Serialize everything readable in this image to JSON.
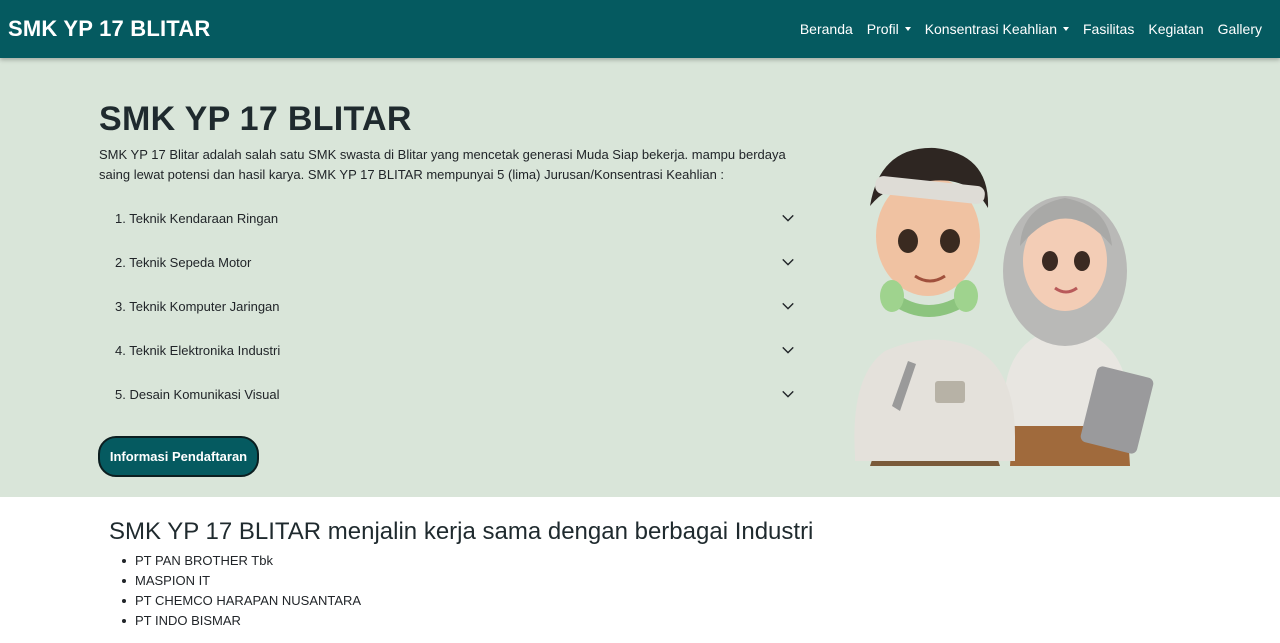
{
  "navbar": {
    "brand": "SMK YP 17 BLITAR",
    "items": [
      {
        "label": "Beranda",
        "dropdown": false
      },
      {
        "label": "Profil",
        "dropdown": true
      },
      {
        "label": "Konsentrasi Keahlian",
        "dropdown": true
      },
      {
        "label": "Fasilitas",
        "dropdown": false
      },
      {
        "label": "Kegiatan",
        "dropdown": false
      },
      {
        "label": "Gallery",
        "dropdown": false
      }
    ]
  },
  "hero": {
    "title": "SMK YP 17 BLITAR",
    "description": "SMK YP 17 Blitar adalah salah satu SMK swasta di Blitar yang mencetak generasi Muda Siap bekerja. mampu berdaya saing lewat potensi dan hasil karya. SMK YP 17 BLITAR mempunyai 5 (lima) Jurusan/Konsentrasi Keahlian :",
    "majors": [
      "1. Teknik Kendaraan Ringan",
      "2. Teknik Sepeda Motor",
      "3. Teknik Komputer Jaringan",
      "4. Teknik Elektronika Industri",
      "5. Desain Komunikasi Visual"
    ],
    "cta_label": "Informasi Pendaftaran"
  },
  "industry": {
    "title": "SMK YP 17 BLITAR menjalin kerja sama dengan berbagai Industri",
    "partners": [
      "PT PAN BROTHER Tbk",
      "MASPION IT",
      "PT CHEMCO HARAPAN NUSANTARA",
      "PT INDO BISMAR"
    ]
  },
  "colors": {
    "navbar_bg": "#055a60",
    "hero_bg": "#d9e5d9",
    "button_bg": "#055a60"
  }
}
